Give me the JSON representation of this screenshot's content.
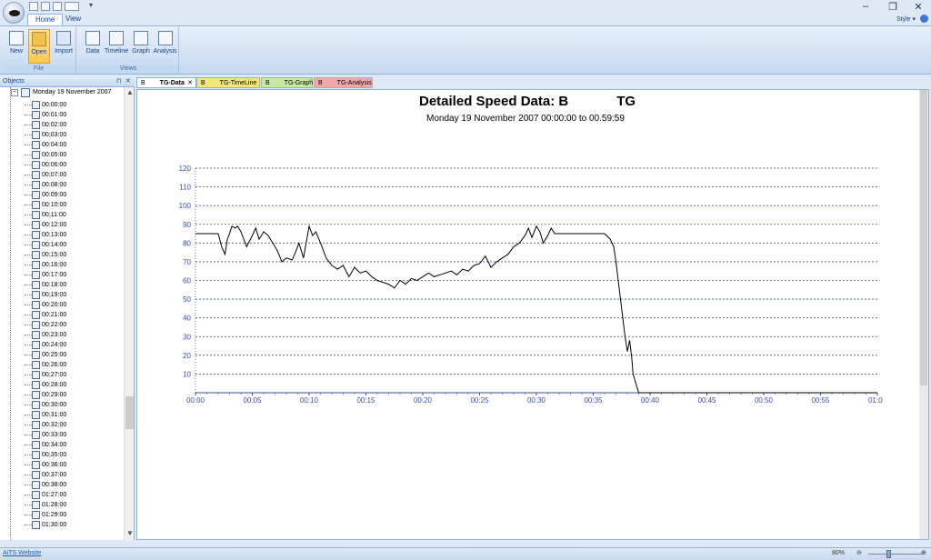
{
  "window": {
    "style_label": "Style"
  },
  "ribbon": {
    "tabs": [
      {
        "label": "Home"
      },
      {
        "label": "View"
      }
    ],
    "groups": {
      "file": {
        "label": "File",
        "buttons": [
          {
            "label": "New"
          },
          {
            "label": "Open"
          },
          {
            "label": "Import"
          }
        ]
      },
      "views": {
        "label": "Views",
        "buttons": [
          {
            "label": "Data"
          },
          {
            "label": "Timeline"
          },
          {
            "label": "Graph"
          },
          {
            "label": "Analysis"
          }
        ]
      }
    }
  },
  "objects_panel": {
    "title": "Objects",
    "date_node": "Monday 19 November 2007",
    "items": [
      "00:00:00",
      "00:01:00",
      "00:02:00",
      "00:03:00",
      "00:04:00",
      "00:05:00",
      "00:06:00",
      "00:07:00",
      "00:08:00",
      "00:09:00",
      "00:10:00",
      "00:11:00",
      "00:12:00",
      "00:13:00",
      "00:14:00",
      "00:15:00",
      "00:16:00",
      "00:17:00",
      "00:18:00",
      "00:19:00",
      "00:20:00",
      "00:21:00",
      "00:22:00",
      "00:23:00",
      "00:24:00",
      "00:25:00",
      "00:26:00",
      "00:27:00",
      "00:28:00",
      "00:29:00",
      "00:30:00",
      "00:31:00",
      "00:32:00",
      "00:33:00",
      "00:34:00",
      "00:35:00",
      "00:36:00",
      "00:37:00",
      "00:38:00",
      "01:27:00",
      "01:28:00",
      "01:29:00",
      "01:30:00"
    ]
  },
  "doc_tabs": [
    {
      "prefix": "B",
      "label": "TG-Data",
      "active": true,
      "color": "#ffffff"
    },
    {
      "prefix": "B",
      "label": "TG-TimeLine",
      "active": false,
      "color": "#f5e67a"
    },
    {
      "prefix": "B",
      "label": "TG-Graph",
      "active": false,
      "color": "#c9e8a0"
    },
    {
      "prefix": "B",
      "label": "TG-Analysis",
      "active": false,
      "color": "#f0a8a8"
    }
  ],
  "status": {
    "link": "AiTS Website",
    "zoom": "80%"
  },
  "chart_data": {
    "type": "line",
    "title": "Detailed Speed Data: B",
    "title_suffix": "TG",
    "subtitle": "Monday 19 November 2007 00:00:00 to 00.59:59",
    "xlabel": "",
    "ylabel": "",
    "x_ticks": [
      "00:00",
      "00:05",
      "00:10",
      "00:15",
      "00:20",
      "00:25",
      "00:30",
      "00:35",
      "00:40",
      "00:45",
      "00:50",
      "00:55",
      "01:00"
    ],
    "y_ticks": [
      10,
      20,
      30,
      40,
      50,
      60,
      70,
      80,
      90,
      100,
      110,
      120
    ],
    "xlim": [
      0,
      60
    ],
    "ylim": [
      0,
      120
    ],
    "grid": "horizontal dotted",
    "line_color": "#000000",
    "series": [
      {
        "x": [
          0,
          2,
          2.3,
          2.6,
          2.8,
          3,
          3.2,
          3.5,
          3.7,
          4,
          4.5,
          5,
          5.3,
          5.6,
          6,
          6.4,
          6.8,
          7.2,
          7.6,
          8,
          8.5,
          8.8,
          9.1,
          9.5,
          10,
          10.3,
          10.6,
          11,
          11.5,
          12,
          12.5,
          13,
          13.5,
          14,
          14.5,
          15,
          15.5,
          16,
          16.5,
          17,
          17.5,
          18,
          18.5,
          19,
          19.5,
          20,
          20.5,
          21,
          21.5,
          22,
          22.5,
          23,
          23.5,
          24,
          24.5,
          25,
          25.5,
          26,
          26.5,
          27,
          27.5,
          28,
          28.5,
          29,
          29.3,
          29.6,
          30,
          30.3,
          30.6,
          31,
          31.3,
          31.6,
          32,
          33,
          34,
          35,
          36,
          36.5,
          36.8,
          37,
          37.3,
          37.6,
          37.8,
          38,
          38.2,
          38.4,
          38.5,
          38.7,
          39,
          45,
          50,
          55,
          60
        ],
        "y": [
          85,
          85,
          78,
          74,
          82,
          85,
          89,
          88,
          89,
          86,
          78,
          84,
          88,
          82,
          86,
          84,
          80,
          76,
          70,
          72,
          71,
          75,
          80,
          72,
          89,
          84,
          86,
          80,
          72,
          68,
          66,
          68,
          62,
          67,
          64,
          65,
          62,
          60,
          59,
          58,
          56,
          60,
          58,
          61,
          60,
          62,
          64,
          62,
          63,
          64,
          65,
          63,
          66,
          65,
          68,
          69,
          73,
          67,
          70,
          72,
          74,
          78,
          80,
          84,
          88,
          83,
          89,
          86,
          80,
          84,
          88,
          85,
          85,
          85,
          85,
          85,
          85,
          82,
          78,
          70,
          55,
          40,
          30,
          22,
          28,
          18,
          10,
          6,
          0,
          0,
          0,
          0,
          0
        ]
      }
    ]
  }
}
